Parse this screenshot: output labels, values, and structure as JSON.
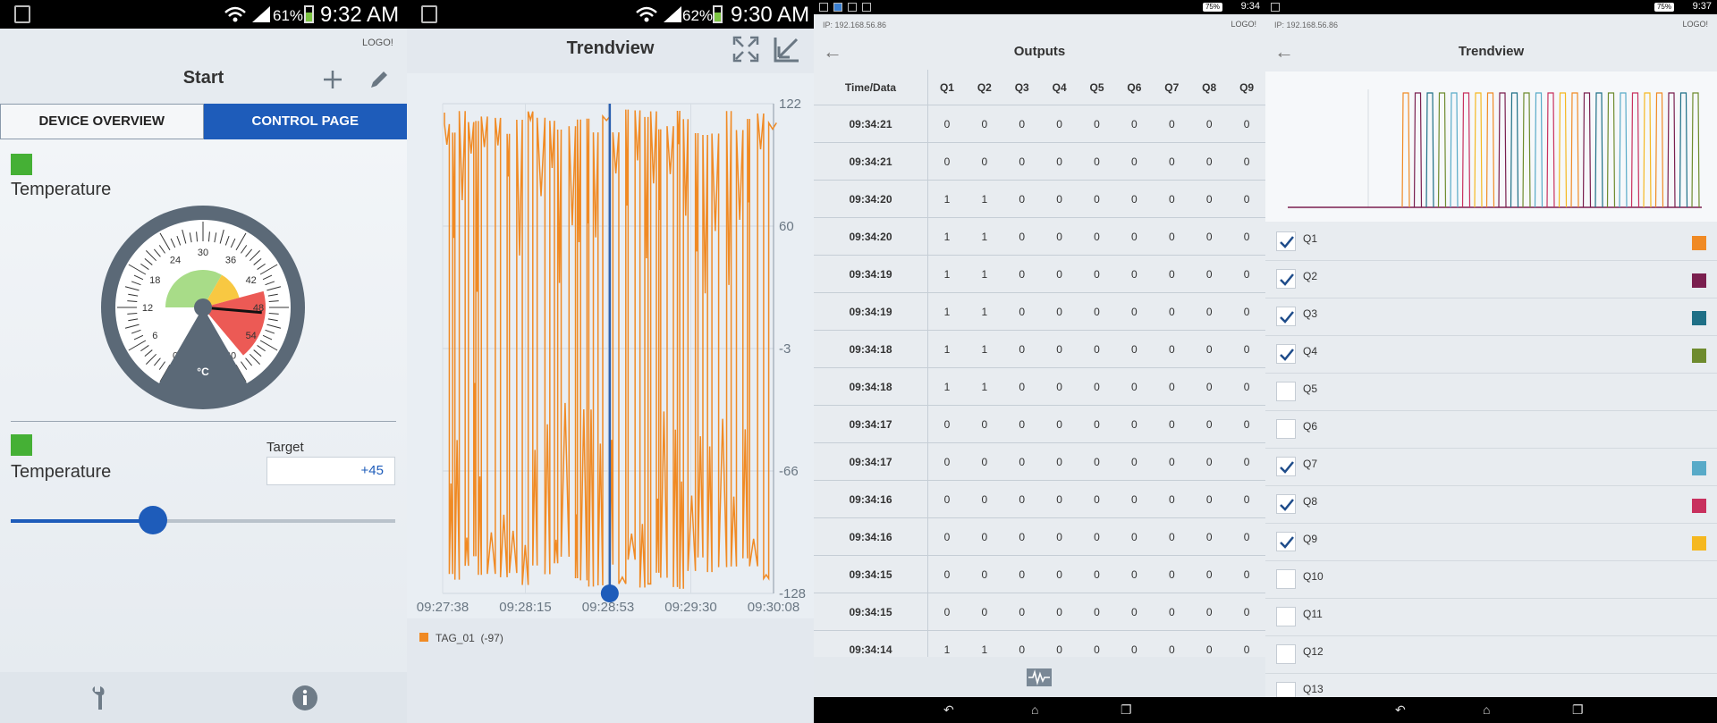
{
  "panel1": {
    "status": {
      "battery": "61%",
      "time": "9:32 AM"
    },
    "logo": "LOGO!",
    "title": "Start",
    "tabs": [
      {
        "label": "DEVICE OVERVIEW"
      },
      {
        "label": "CONTROL PAGE"
      }
    ],
    "gauge": {
      "label": "Temperature",
      "unit": "°C",
      "ticks": [
        "0",
        "6",
        "12",
        "18",
        "24",
        "30",
        "36",
        "42",
        "48",
        "54",
        "60"
      ],
      "value": 49
    },
    "control": {
      "label": "Temperature",
      "target_label": "Target",
      "target_value": "+45",
      "slider_fraction": 0.37
    },
    "colors": {
      "accent": "#1e5cba",
      "status_green": "#45b035"
    },
    "footer_icons": [
      "wrench-icon",
      "info-icon"
    ]
  },
  "panel2": {
    "status": {
      "battery": "62%",
      "time": "9:30 AM"
    },
    "title": "Trendview",
    "y_ticks": [
      "122",
      "60",
      "-3",
      "-66",
      "-128"
    ],
    "x_ticks": [
      "09:27:38",
      "09:28:15",
      "09:28:53",
      "09:29:30",
      "09:30:08"
    ],
    "legend": {
      "name": "TAG_01",
      "value": "(-97)"
    },
    "line_color": "#f08a24",
    "cursor_fraction": 0.505
  },
  "panel3": {
    "status": {
      "time": "9:34",
      "battery": "75%"
    },
    "ip": "IP: 192.168.56.86",
    "logo": "LOGO!",
    "title": "Outputs",
    "columns": [
      "Time/Data",
      "Q1",
      "Q2",
      "Q3",
      "Q4",
      "Q5",
      "Q6",
      "Q7",
      "Q8",
      "Q9"
    ],
    "rows": [
      [
        "09:34:21",
        "0",
        "0",
        "0",
        "0",
        "0",
        "0",
        "0",
        "0",
        "0"
      ],
      [
        "09:34:21",
        "0",
        "0",
        "0",
        "0",
        "0",
        "0",
        "0",
        "0",
        "0"
      ],
      [
        "09:34:20",
        "1",
        "1",
        "0",
        "0",
        "0",
        "0",
        "0",
        "0",
        "0"
      ],
      [
        "09:34:20",
        "1",
        "1",
        "0",
        "0",
        "0",
        "0",
        "0",
        "0",
        "0"
      ],
      [
        "09:34:19",
        "1",
        "1",
        "0",
        "0",
        "0",
        "0",
        "0",
        "0",
        "0"
      ],
      [
        "09:34:19",
        "1",
        "1",
        "0",
        "0",
        "0",
        "0",
        "0",
        "0",
        "0"
      ],
      [
        "09:34:18",
        "1",
        "1",
        "0",
        "0",
        "0",
        "0",
        "0",
        "0",
        "0"
      ],
      [
        "09:34:18",
        "1",
        "1",
        "0",
        "0",
        "0",
        "0",
        "0",
        "0",
        "0"
      ],
      [
        "09:34:17",
        "0",
        "0",
        "0",
        "0",
        "0",
        "0",
        "0",
        "0",
        "0"
      ],
      [
        "09:34:17",
        "0",
        "0",
        "0",
        "0",
        "0",
        "0",
        "0",
        "0",
        "0"
      ],
      [
        "09:34:16",
        "0",
        "0",
        "0",
        "0",
        "0",
        "0",
        "0",
        "0",
        "0"
      ],
      [
        "09:34:16",
        "0",
        "0",
        "0",
        "0",
        "0",
        "0",
        "0",
        "0",
        "0"
      ],
      [
        "09:34:15",
        "0",
        "0",
        "0",
        "0",
        "0",
        "0",
        "0",
        "0",
        "0"
      ],
      [
        "09:34:15",
        "0",
        "0",
        "0",
        "0",
        "0",
        "0",
        "0",
        "0",
        "0"
      ],
      [
        "09:34:14",
        "1",
        "1",
        "0",
        "0",
        "0",
        "0",
        "0",
        "0",
        "0"
      ]
    ]
  },
  "panel4": {
    "status": {
      "time": "9:37",
      "battery": "75%"
    },
    "ip": "IP: 192.168.56.86",
    "logo": "LOGO!",
    "title": "Trendview",
    "outputs": [
      {
        "label": "Q1",
        "checked": true,
        "color": "#f08a24"
      },
      {
        "label": "Q2",
        "checked": true,
        "color": "#7a1f4f"
      },
      {
        "label": "Q3",
        "checked": true,
        "color": "#1e6f86"
      },
      {
        "label": "Q4",
        "checked": true,
        "color": "#6e8b2e"
      },
      {
        "label": "Q5",
        "checked": false,
        "color": ""
      },
      {
        "label": "Q6",
        "checked": false,
        "color": ""
      },
      {
        "label": "Q7",
        "checked": true,
        "color": "#58aac8"
      },
      {
        "label": "Q8",
        "checked": true,
        "color": "#c8305e"
      },
      {
        "label": "Q9",
        "checked": true,
        "color": "#f5b820"
      },
      {
        "label": "Q10",
        "checked": false,
        "color": ""
      },
      {
        "label": "Q11",
        "checked": false,
        "color": ""
      },
      {
        "label": "Q12",
        "checked": false,
        "color": ""
      },
      {
        "label": "Q13",
        "checked": false,
        "color": ""
      }
    ]
  }
}
